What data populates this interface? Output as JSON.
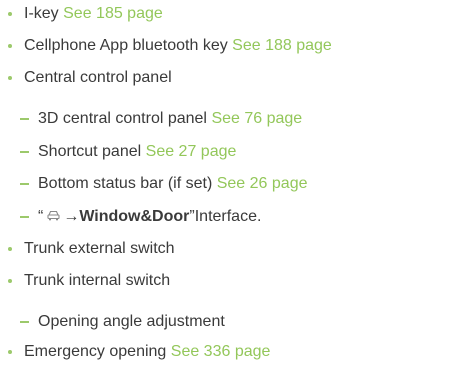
{
  "colors": {
    "text": "#3a3a3a",
    "accent": "#93c75a",
    "bullet": "#9cc96b"
  },
  "items": [
    {
      "text": "I-key",
      "ref": "See 185 page"
    },
    {
      "text": "Cellphone App bluetooth key",
      "ref": "See 188 page"
    },
    {
      "text": "Central control panel"
    },
    {
      "text": "3D central control panel",
      "ref": "See 76 page"
    },
    {
      "text": "Shortcut panel",
      "ref": "See 27 page"
    },
    {
      "text": "Bottom status bar (if set)",
      "ref": "See 26 page"
    },
    {
      "quote_open": "“",
      "icon": "car-icon",
      "arrow": "→",
      "bold": "Window&Door",
      "quote_close": "”",
      "tail": "Interface."
    },
    {
      "text": "Trunk external switch"
    },
    {
      "text": "Trunk internal switch"
    },
    {
      "text": "Opening angle adjustment"
    },
    {
      "text": "Emergency opening",
      "ref": "See 336 page"
    }
  ]
}
